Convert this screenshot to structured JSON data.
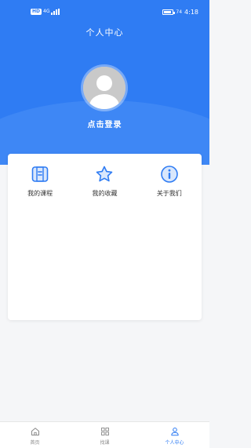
{
  "status_bar": {
    "sim": "HD",
    "network": "4G",
    "battery": "74",
    "time": "4:18"
  },
  "header": {
    "title": "个人中心",
    "login_text": "点击登录"
  },
  "menu": {
    "items": [
      {
        "label": "我的课程",
        "icon": "course-book-icon"
      },
      {
        "label": "我的收藏",
        "icon": "star-icon"
      },
      {
        "label": "关于我们",
        "icon": "info-icon"
      }
    ]
  },
  "tabbar": {
    "items": [
      {
        "label": "首页",
        "icon": "home-icon"
      },
      {
        "label": "找课",
        "icon": "grid-icon"
      },
      {
        "label": "个人中心",
        "icon": "person-icon",
        "active": true
      }
    ]
  },
  "colors": {
    "primary": "#2f7cf3",
    "icon_fill": "#d9e7fc"
  }
}
